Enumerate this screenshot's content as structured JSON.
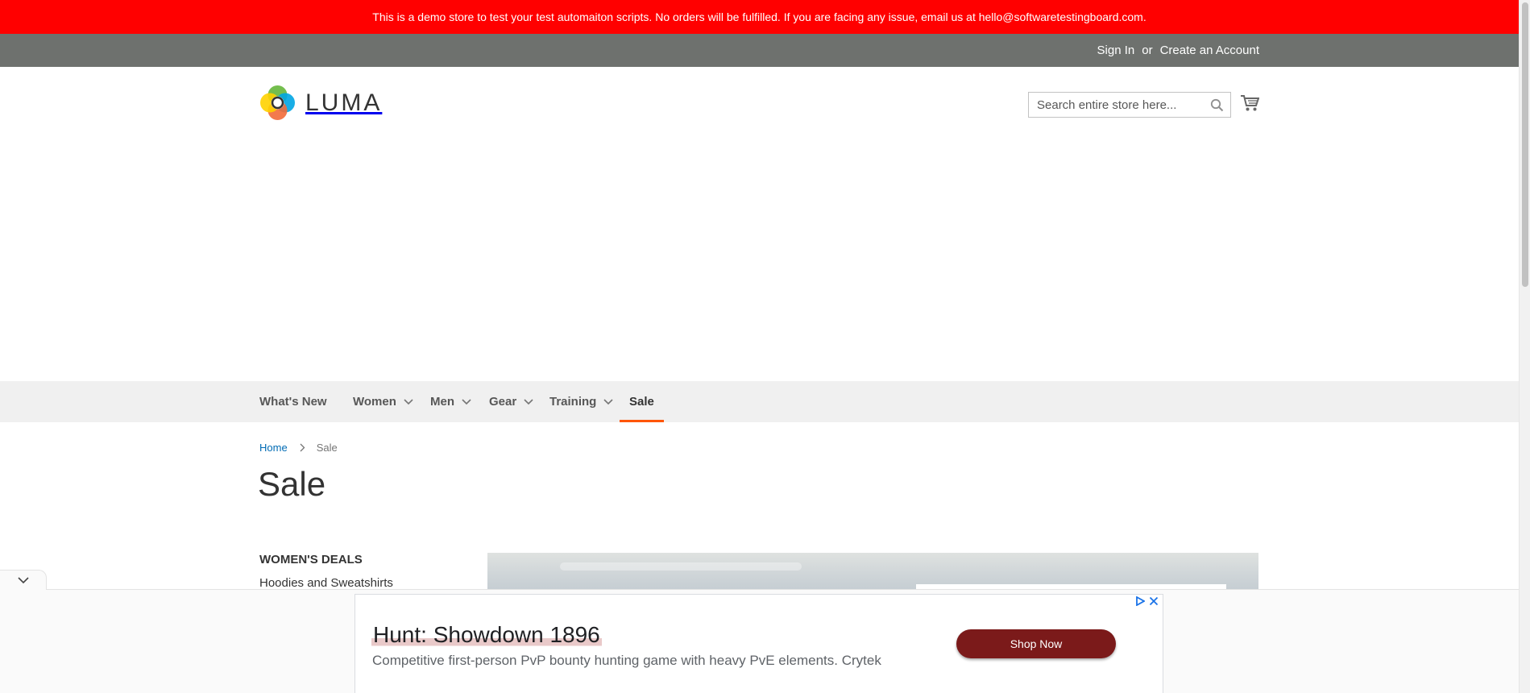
{
  "demo_banner": {
    "text": "This is a demo store to test your test automaiton scripts. No orders will be fulfilled. If you are facing any issue, email us at hello@softwaretestingboard.com."
  },
  "header": {
    "sign_in": "Sign In",
    "or": "or",
    "create_account": "Create an Account"
  },
  "logo": {
    "text": "LUMA",
    "icon": "luma-logo-icon"
  },
  "search": {
    "placeholder": "Search entire store here...",
    "icon": "search-icon"
  },
  "cart": {
    "icon": "cart-icon"
  },
  "nav": {
    "items": [
      {
        "label": "What's New",
        "has_dropdown": false
      },
      {
        "label": "Women",
        "has_dropdown": true
      },
      {
        "label": "Men",
        "has_dropdown": true
      },
      {
        "label": "Gear",
        "has_dropdown": true
      },
      {
        "label": "Training",
        "has_dropdown": true
      },
      {
        "label": "Sale",
        "has_dropdown": false,
        "active": true
      }
    ]
  },
  "breadcrumb": {
    "home": "Home",
    "current": "Sale"
  },
  "page": {
    "title": "Sale"
  },
  "sidebar": {
    "title": "WOMEN'S DEALS",
    "links": [
      "Hoodies and Sweatshirts"
    ]
  },
  "ad": {
    "title": "Hunt: Showdown 1896",
    "description": "Competitive first-person PvP bounty hunting game with heavy PvE elements. Crytek",
    "cta": "Shop Now"
  },
  "colors": {
    "banner_red": "#ff0000",
    "header_gray": "#6e716e",
    "nav_active": "#ff5501",
    "link_blue": "#006bb4",
    "ad_button": "#7b1a1a"
  }
}
